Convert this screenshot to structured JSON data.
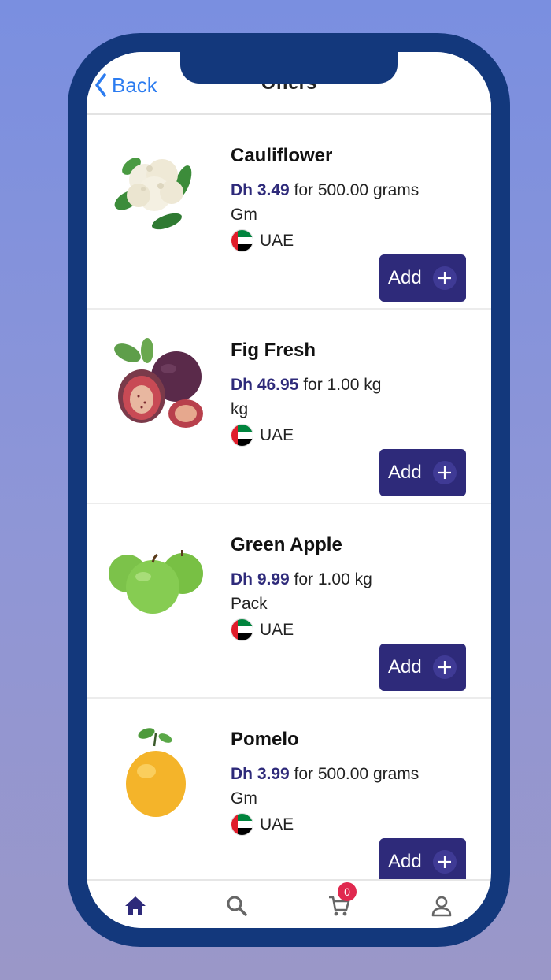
{
  "nav": {
    "back_label": "Back",
    "title": "Offers"
  },
  "products": [
    {
      "name": "Cauliflower",
      "price": "Dh 3.49",
      "price_detail": " for 500.00 grams",
      "unit": "Gm",
      "origin": "UAE",
      "add_label": "Add"
    },
    {
      "name": "Fig Fresh",
      "price": "Dh 46.95",
      "price_detail": " for 1.00 kg",
      "unit": "kg",
      "origin": "UAE",
      "add_label": "Add"
    },
    {
      "name": "Green Apple",
      "price": "Dh 9.99",
      "price_detail": " for 1.00 kg",
      "unit": "Pack",
      "origin": "UAE",
      "add_label": "Add"
    },
    {
      "name": "Pomelo",
      "price": "Dh 3.99",
      "price_detail": " for 500.00 grams",
      "unit": "Gm",
      "origin": "UAE",
      "add_label": "Add"
    }
  ],
  "tabbar": {
    "items": [
      "home-icon",
      "search-icon",
      "cart-icon",
      "user-icon"
    ],
    "cart_count": "0"
  },
  "colors": {
    "accent": "#2e2a7a",
    "link": "#2c7cf0",
    "frame": "#13387c",
    "badge": "#e0294f"
  }
}
